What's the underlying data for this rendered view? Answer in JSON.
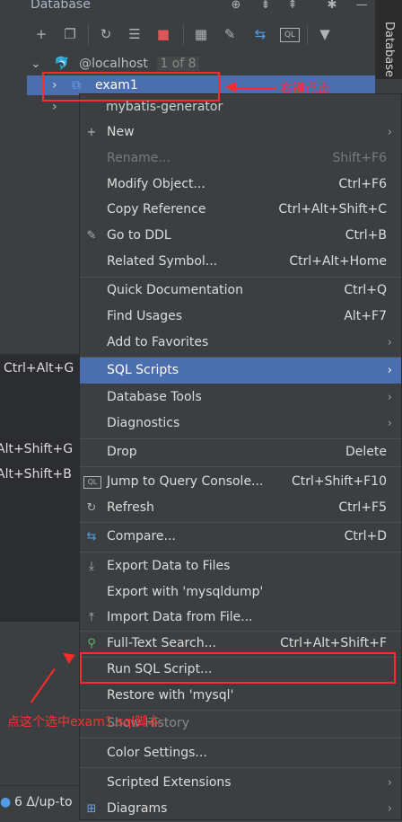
{
  "panel": {
    "title": "Database",
    "right_tab": "Database"
  },
  "tree": {
    "connection": "@localhost",
    "connection_badge": "1 of 8",
    "selected_node": "exam1",
    "behind_node": "mybatis-generator"
  },
  "context_menu": {
    "items": [
      {
        "label": "New",
        "shortcut": "",
        "submenu": true
      },
      {
        "label": "Rename...",
        "shortcut": "Shift+F6",
        "disabled": true
      },
      {
        "label": "Modify Object...",
        "shortcut": "Ctrl+F6"
      },
      {
        "label": "Copy Reference",
        "shortcut": "Ctrl+Alt+Shift+C"
      },
      {
        "label": "Go to DDL",
        "shortcut": "Ctrl+B"
      },
      {
        "label": "Related Symbol...",
        "shortcut": "Ctrl+Alt+Home"
      },
      {
        "label": "Quick Documentation",
        "shortcut": "Ctrl+Q"
      },
      {
        "label": "Find Usages",
        "shortcut": "Alt+F7"
      },
      {
        "label": "Add to Favorites",
        "shortcut": "",
        "submenu": true
      },
      {
        "label": "SQL Scripts",
        "shortcut": "",
        "submenu": true,
        "highlighted": true
      },
      {
        "label": "Database Tools",
        "shortcut": "",
        "submenu": true
      },
      {
        "label": "Diagnostics",
        "shortcut": "",
        "submenu": true
      },
      {
        "label": "Drop",
        "shortcut": "Delete"
      },
      {
        "label": "Jump to Query Console...",
        "shortcut": "Ctrl+Shift+F10"
      },
      {
        "label": "Refresh",
        "shortcut": "Ctrl+F5"
      },
      {
        "label": "Compare...",
        "shortcut": "Ctrl+D"
      },
      {
        "label": "Export Data to Files",
        "shortcut": ""
      },
      {
        "label": "Export with 'mysqldump'",
        "shortcut": ""
      },
      {
        "label": "Import Data from File...",
        "shortcut": ""
      },
      {
        "label": "Full-Text Search...",
        "shortcut": "Ctrl+Alt+Shift+F"
      },
      {
        "label": "Run SQL Script...",
        "shortcut": ""
      },
      {
        "label": "Restore with 'mysql'",
        "shortcut": ""
      },
      {
        "label": "Show History",
        "shortcut": ""
      },
      {
        "label": "Color Settings...",
        "shortcut": ""
      },
      {
        "label": "Scripted Extensions",
        "shortcut": "",
        "submenu": true
      },
      {
        "label": "Diagrams",
        "shortcut": "",
        "submenu": true
      }
    ]
  },
  "left_submenu": {
    "items": [
      "Ctrl+Alt+G",
      "Alt+Shift+G",
      "Alt+Shift+B"
    ]
  },
  "annotations": {
    "right_click": "右键点击",
    "click_this": "点这个选中exam1.sql脚本"
  },
  "bottom": {
    "status": "6 Δ/up-to"
  },
  "colors": {
    "accent": "#4b6eaf",
    "annotation": "#ff2a2a",
    "background": "#3c3f41"
  },
  "icons": {
    "header": [
      "globe-icon",
      "collapse-all-icon",
      "expand-all-icon",
      "settings-icon",
      "minimize-icon"
    ],
    "toolbar": [
      "add-icon",
      "duplicate-icon",
      "refresh-icon",
      "properties-icon",
      "stop-icon",
      "table-icon",
      "edit-icon",
      "compare-icon",
      "query-console-icon",
      "filter-icon"
    ]
  }
}
